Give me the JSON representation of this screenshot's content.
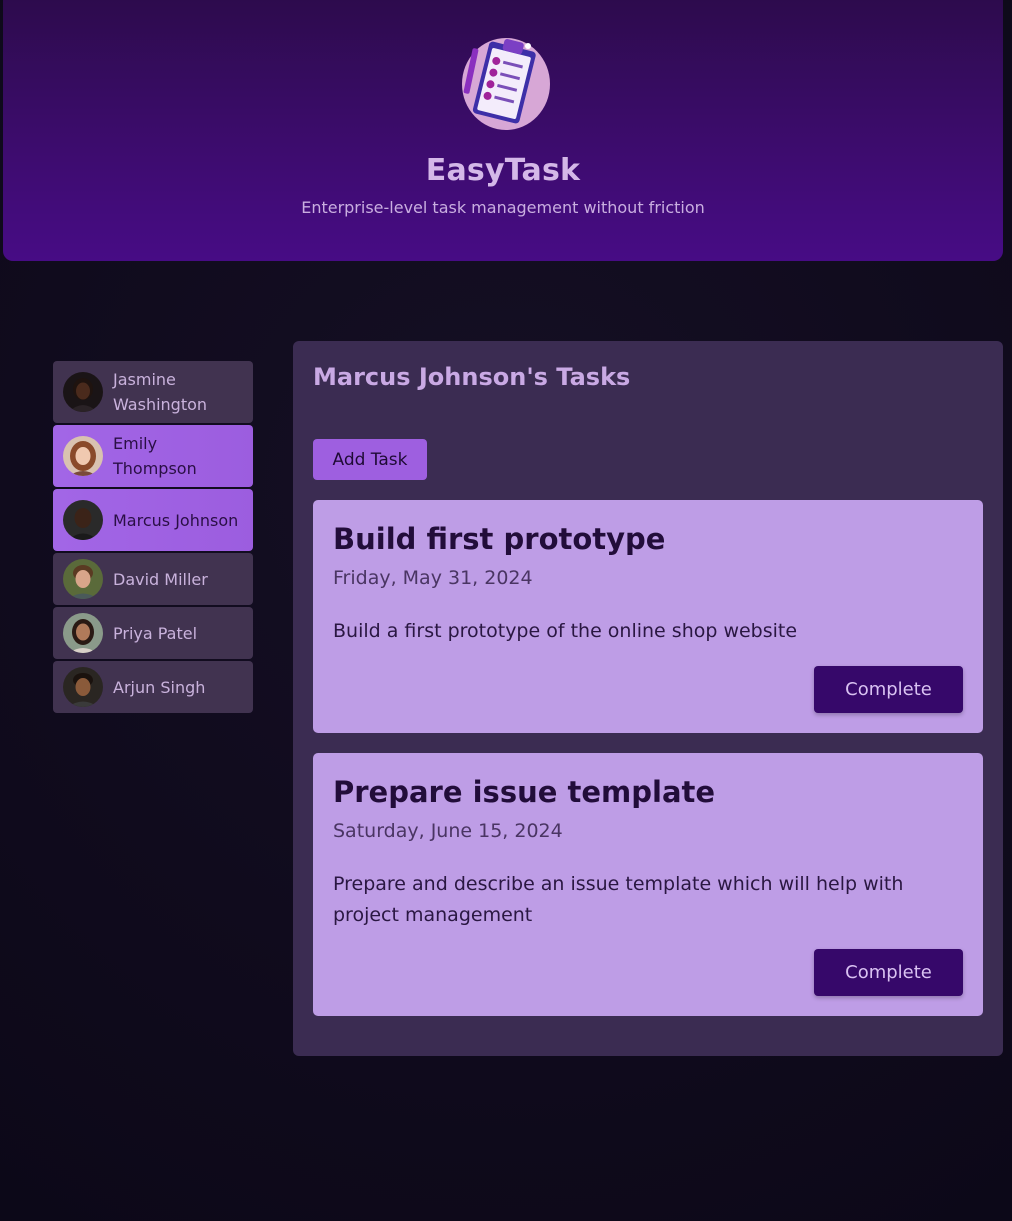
{
  "header": {
    "title": "EasyTask",
    "subtitle": "Enterprise-level task management without friction",
    "logo_icon": "clipboard-task-list-icon"
  },
  "sidebar": {
    "users": [
      {
        "name": "Jasmine Washington",
        "selected": false
      },
      {
        "name": "Emily Thompson",
        "selected": true
      },
      {
        "name": "Marcus Johnson",
        "selected": true
      },
      {
        "name": "David Miller",
        "selected": false
      },
      {
        "name": "Priya Patel",
        "selected": false
      },
      {
        "name": "Arjun Singh",
        "selected": false
      }
    ]
  },
  "main": {
    "title": "Marcus Johnson's Tasks",
    "add_task_label": "Add Task",
    "tasks": [
      {
        "title": "Build first prototype",
        "date": "Friday, May 31, 2024",
        "description": "Build a first prototype of the online shop website",
        "complete_label": "Complete"
      },
      {
        "title": "Prepare issue template",
        "date": "Saturday, June 15, 2024",
        "description": "Prepare and describe an issue template which will help with project management",
        "complete_label": "Complete"
      }
    ]
  },
  "colors": {
    "header_top": "#2d0b4d",
    "header_bottom": "#470c85",
    "page_background": "#100b1d",
    "user_item": "#413350",
    "user_item_selected": "#a266e6",
    "panel": "#3b2c52",
    "task_card": "#be9de6",
    "complete_button": "#36086a",
    "add_task_button": "#9e5fe0"
  }
}
